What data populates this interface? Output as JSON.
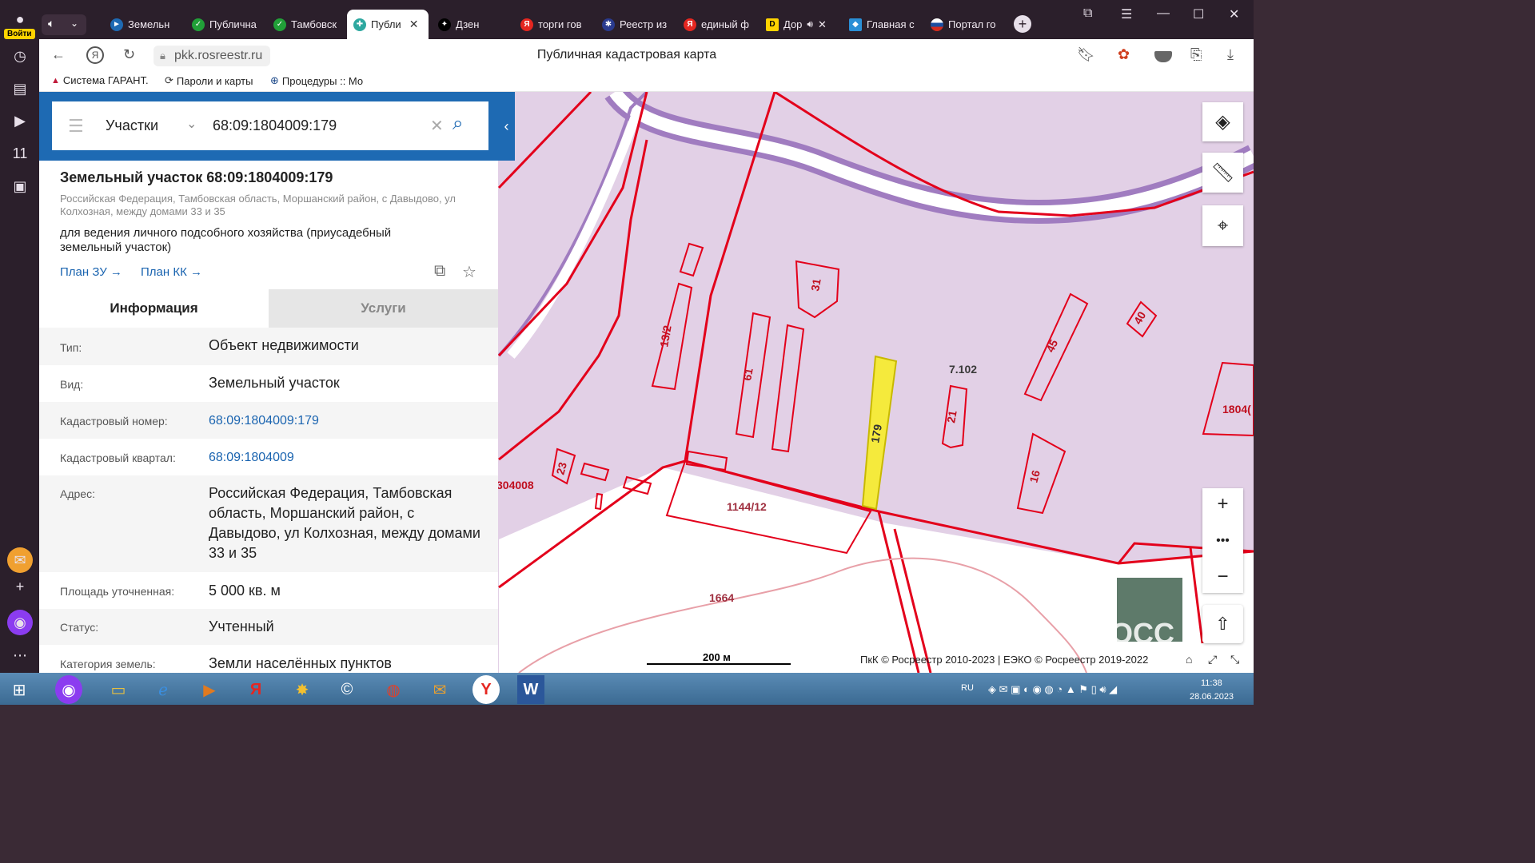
{
  "browser": {
    "login_label": "Войти",
    "tabs": [
      {
        "label": "Земельн",
        "fav_color": "#1e6ab3",
        "fav_glyph": "►"
      },
      {
        "label": "Публична",
        "fav_color": "#21a038",
        "fav_glyph": "✓"
      },
      {
        "label": "Тамбовск",
        "fav_color": "#21a038",
        "fav_glyph": "✓"
      },
      {
        "label": "Публи",
        "fav_color": "#2ea8a0",
        "fav_glyph": "✚",
        "active": true
      },
      {
        "label": "Дзен",
        "fav_color": "#000000",
        "fav_glyph": "✦"
      },
      {
        "label": "торги гов",
        "fav_color": "#e52620",
        "fav_glyph": "Я"
      },
      {
        "label": "Реестр из",
        "fav_color": "#2a3b8f",
        "fav_glyph": "✱"
      },
      {
        "label": "единый ф",
        "fav_color": "#e52620",
        "fav_glyph": "Я"
      },
      {
        "label": "Дор",
        "fav_color": "#ffd300",
        "fav_glyph": "D"
      },
      {
        "label": "Главная с",
        "fav_color": "#2a8fd6",
        "fav_glyph": "◆"
      },
      {
        "label": "Портал го",
        "fav_color": "#d52b1e",
        "fav_glyph": "●"
      }
    ],
    "url": "pkk.rosreestr.ru",
    "page_title": "Публичная кадастровая карта",
    "bookmarks": [
      {
        "label": "Система ГАРАНТ.",
        "glyph": "▲"
      },
      {
        "label": "Пароли и карты",
        "glyph": "⟳"
      },
      {
        "label": "Процедуры :: Мо",
        "glyph": "⊕"
      }
    ]
  },
  "search": {
    "category": "Участки",
    "query": "68:09:1804009:179"
  },
  "parcel": {
    "title": "Земельный участок 68:09:1804009:179",
    "address_short": "Российская Федерация, Тамбовская область, Моршанский район, с Давыдово, ул Колхозная, между домами 33 и 35",
    "purpose": "для ведения личного подсобного хозяйства (приусадебный земельный участок)",
    "link_plan_zu": "План ЗУ →",
    "link_plan_kk": "План КК →"
  },
  "tabs_panel": {
    "info": "Информация",
    "services": "Услуги"
  },
  "info_rows": [
    {
      "label": "Тип:",
      "value": "Объект недвижимости"
    },
    {
      "label": "Вид:",
      "value": "Земельный участок"
    },
    {
      "label": "Кадастровый номер:",
      "value": "68:09:1804009:179"
    },
    {
      "label": "Кадастровый квартал:",
      "value": "68:09:1804009"
    },
    {
      "label": "Адрес:",
      "value": "Российская Федерация, Тамбовская область, Моршанский район, с Давыдово, ул Колхозная, между домами 33 и 35"
    },
    {
      "label": "Площадь уточненная:",
      "value": "5 000 кв. м"
    },
    {
      "label": "Статус:",
      "value": "Учтенный"
    },
    {
      "label": "Категория земель:",
      "value": "Земли населённых пунктов"
    }
  ],
  "map": {
    "labels": [
      "13/2",
      "31",
      "61",
      "179",
      "7.102",
      "21",
      "45",
      "40",
      "23",
      "16",
      "1144/12",
      "1664",
      "304008",
      "1804("
    ],
    "scale": "200 м",
    "copyright": "ПкК © Росреестр 2010-2023 | ЕЭКО © Росреестр 2019-2022"
  },
  "taskbar": {
    "lang": "RU",
    "time": "11:38",
    "date": "28.06.2023"
  },
  "colors": {
    "boundary": "#e3001b",
    "selected_fill": "#f5ea3c",
    "zone_fill": "#e2d0e6",
    "road_stroke": "#a07cc0",
    "header_blue": "#1e6ab3"
  }
}
